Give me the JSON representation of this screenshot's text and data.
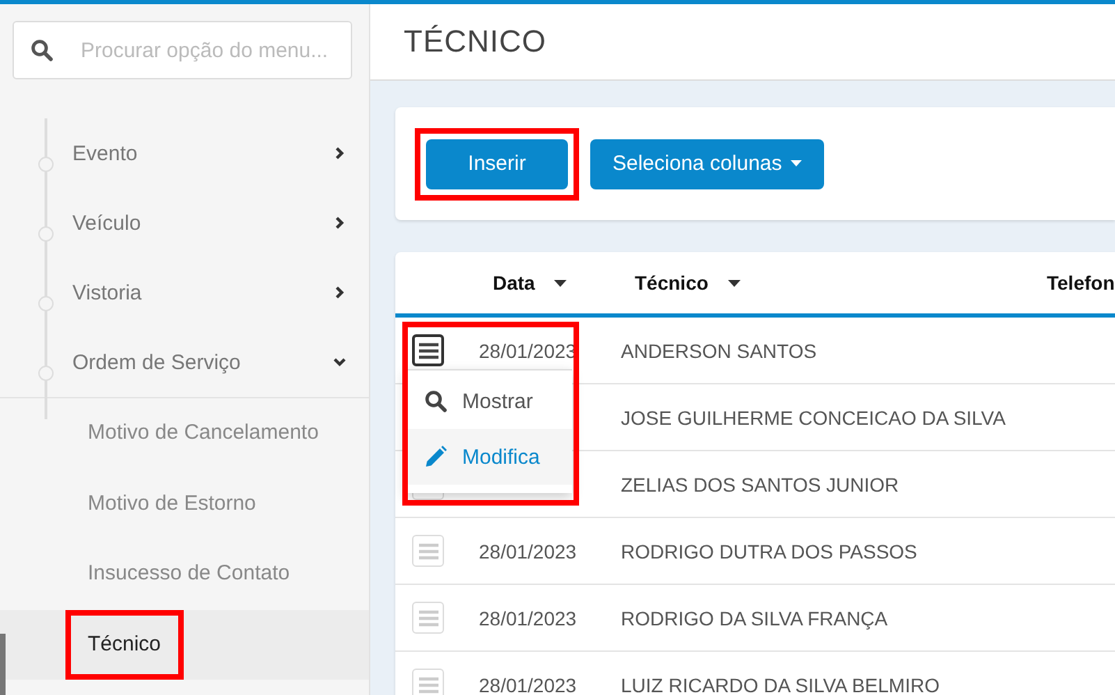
{
  "sidebar": {
    "search": {
      "placeholder": "Procurar opção do menu..."
    },
    "items": [
      {
        "label": "Evento",
        "expanded": false
      },
      {
        "label": "Veículo",
        "expanded": false
      },
      {
        "label": "Vistoria",
        "expanded": false
      },
      {
        "label": "Ordem de Serviço",
        "expanded": true,
        "children": [
          {
            "label": "Motivo de Cancelamento",
            "selected": false,
            "highlighted": false
          },
          {
            "label": "Motivo de Estorno",
            "selected": false,
            "highlighted": false
          },
          {
            "label": "Insucesso de Contato",
            "selected": false,
            "highlighted": false
          },
          {
            "label": "Técnico",
            "selected": true,
            "highlighted": true
          }
        ]
      }
    ]
  },
  "page": {
    "title": "TÉCNICO"
  },
  "toolbar": [
    {
      "label": "Inserir",
      "kind": "button",
      "highlighted": true
    },
    {
      "label": "Seleciona colunas",
      "kind": "dropdown",
      "highlighted": false
    }
  ],
  "table": {
    "columns": [
      {
        "label": "Data",
        "sort_menu": true
      },
      {
        "label": "Técnico",
        "sort_menu": true
      },
      {
        "label": "Telefon",
        "sort_menu": false
      }
    ],
    "rows": [
      {
        "date": "28/01/2023",
        "name": "ANDERSON SANTOS",
        "menu_open": true
      },
      {
        "name": "JOSE GUILHERME CONCEICAO DA SILVA",
        "menu_open": false
      },
      {
        "name": "ZELIAS DOS SANTOS JUNIOR",
        "menu_open": false
      },
      {
        "date": "28/01/2023",
        "name": "RODRIGO DUTRA DOS PASSOS",
        "menu_open": false
      },
      {
        "date": "28/01/2023",
        "name": "RODRIGO DA SILVA FRANÇA",
        "menu_open": false
      },
      {
        "date": "28/01/2023",
        "name": "LUIZ RICARDO DA SILVA BELMIRO",
        "menu_open": false
      }
    ],
    "row_menu": {
      "highlighted": true,
      "items": [
        {
          "label": "Mostrar",
          "kind": "view",
          "hovered": false
        },
        {
          "label": "Modifica",
          "kind": "edit",
          "hovered": true
        }
      ]
    }
  }
}
